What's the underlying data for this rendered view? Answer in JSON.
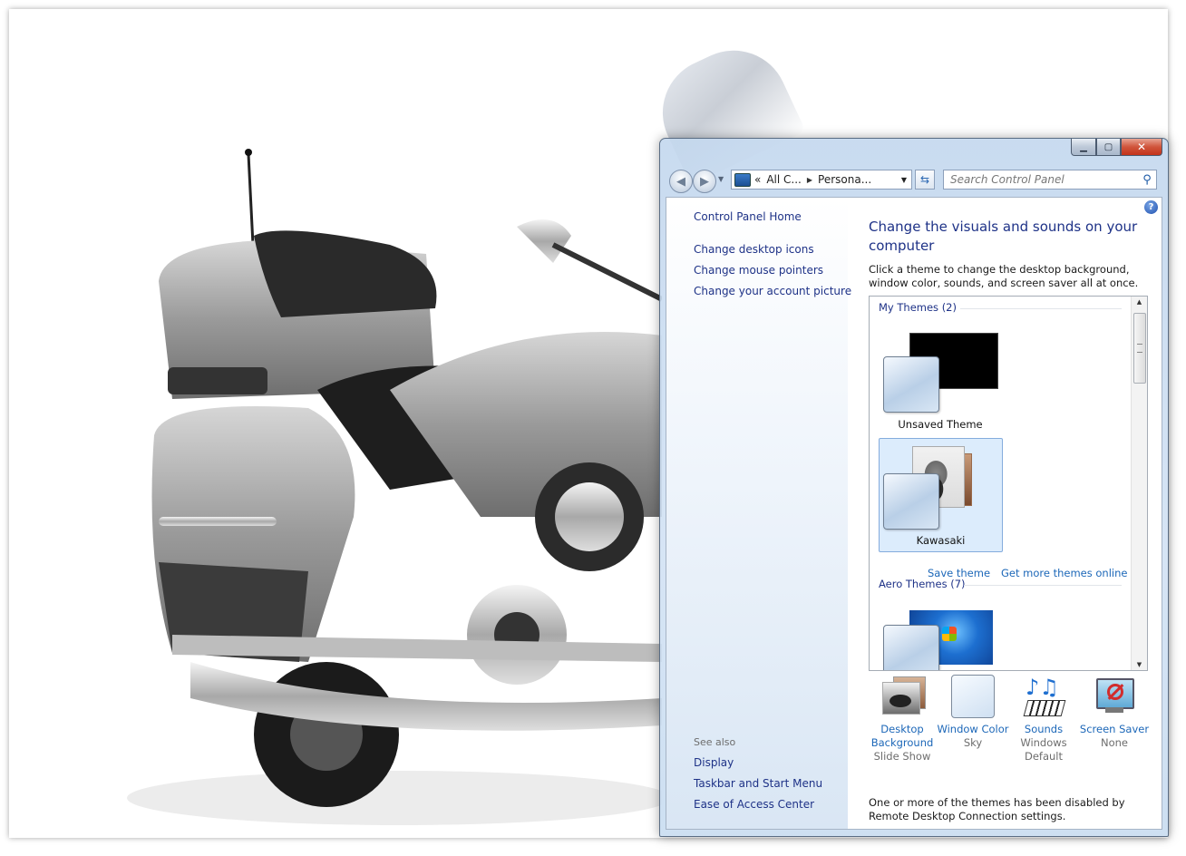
{
  "desktop": {
    "wallpaper_name": "Kawasaki motorcycle wallpaper"
  },
  "window": {
    "caption": {
      "minimize_icon": "minimize-icon",
      "maximize_icon": "maximize-icon",
      "close_icon": "close-icon"
    }
  },
  "navbar": {
    "address_parts": [
      "All C...",
      "Persona..."
    ],
    "address_prefix": "«",
    "search_placeholder": "Search Control Panel"
  },
  "left_pane": {
    "links": [
      "Control Panel Home",
      "Change desktop icons",
      "Change mouse pointers",
      "Change your account picture"
    ],
    "see_also_title": "See also",
    "see_also_links": [
      "Display",
      "Taskbar and Start Menu",
      "Ease of Access Center"
    ]
  },
  "main": {
    "title": "Change the visuals and sounds on your computer",
    "description": "Click a theme to change the desktop background, window color, sounds, and screen saver all at once.",
    "my_themes_header": "My Themes (2)",
    "themes": [
      {
        "name": "Unsaved Theme",
        "selected": false
      },
      {
        "name": "Kawasaki",
        "selected": true
      }
    ],
    "save_theme_link": "Save theme",
    "get_more_link": "Get more themes online",
    "aero_themes_header": "Aero Themes (7)",
    "tiles": [
      {
        "label": "Desktop Background",
        "value": "Slide Show",
        "icon": "desktop-background-icon"
      },
      {
        "label": "Window Color",
        "value": "Sky",
        "icon": "window-color-icon"
      },
      {
        "label": "Sounds",
        "value": "Windows Default",
        "icon": "sounds-icon"
      },
      {
        "label": "Screen Saver",
        "value": "None",
        "icon": "screen-saver-icon"
      }
    ],
    "bottom_note": "One or more of the themes has been disabled by Remote Desktop Connection settings."
  },
  "colors": {
    "link": "#1e3287",
    "link_light": "#1c67b8",
    "selection": "#dcecfc"
  }
}
